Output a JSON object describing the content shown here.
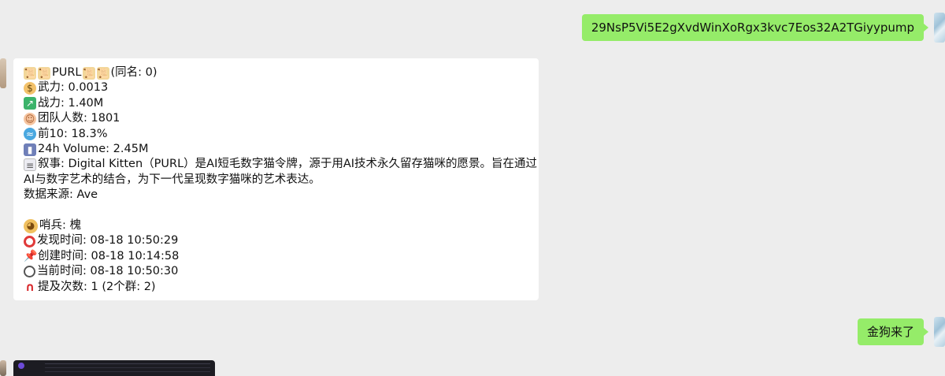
{
  "messages": {
    "sent_address": "29NsP5Vi5E2gXvdWinXoRgx3kvc7Eos32A2TGiyypump",
    "sent_followup": "金狗来了",
    "bot_card": {
      "title_line": "PURL",
      "title_suffix": "(同名: 0)",
      "price": "武力: 0.0013",
      "market_cap": "战力: 1.40M",
      "holders": "团队人数: 1801",
      "top10": "前10: 18.3%",
      "volume": "24h Volume: 2.45M",
      "narrative": "叙事: Digital Kitten（PURL）是AI短毛数字猫令牌，源于用AI技术永久留存猫咪的愿景。旨在通过AI与数字艺术的结合，为下一代呈现数字猫咪的艺术表达。",
      "source": "数据来源: Ave",
      "sentinel": "哨兵: 槐",
      "discovered": "发现时间: 08-18 10:50:29",
      "created": "创建时间: 08-18 10:14:58",
      "current": "当前时间: 08-18 10:50:30",
      "mentions": "提及次数: 1 (2个群: 2)"
    }
  },
  "icons": {
    "scroll": "scroll-icon",
    "money_bag": "money-bag-icon",
    "chart_up": "chart-increasing-icon",
    "face": "person-face-icon",
    "whale": "whale-icon",
    "bar_chart": "bar-chart-icon",
    "memo": "memo-icon",
    "doge": "doge-icon",
    "target": "target-icon",
    "pin": "pushpin-icon",
    "clock": "clock-icon",
    "magnet": "magnet-icon"
  },
  "colors": {
    "background": "#ededed",
    "sent_bubble": "#95ec69",
    "received_bubble": "#ffffff"
  }
}
